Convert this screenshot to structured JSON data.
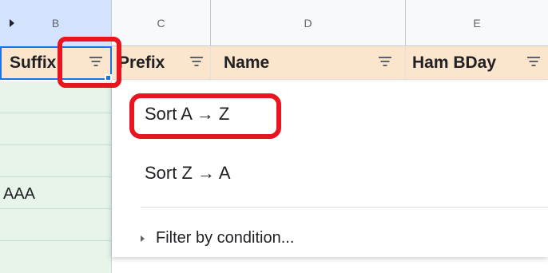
{
  "columns": [
    {
      "letter": "B"
    },
    {
      "letter": "C"
    },
    {
      "letter": "D"
    },
    {
      "letter": "E"
    }
  ],
  "header_row": {
    "suffix": "Suffix",
    "prefix": "Prefix",
    "name": "Name",
    "ham_bday": "Ham BDay"
  },
  "cells": {
    "b_row_4": "AAA"
  },
  "menu": {
    "sort_az": "Sort A → Z",
    "sort_za": "Sort Z → A",
    "filter_by_condition": "Filter by condition..."
  },
  "icons": {
    "filter": "filter-icon",
    "expand": "expand-arrow-icon",
    "submenu": "chevron-right-icon"
  },
  "colors": {
    "header_fill": "#fce5cd",
    "selected_column": "#d3e3fd",
    "column_b_fill": "#e6f4ea",
    "annotation": "#e8141f",
    "selection": "#1a73e8"
  }
}
